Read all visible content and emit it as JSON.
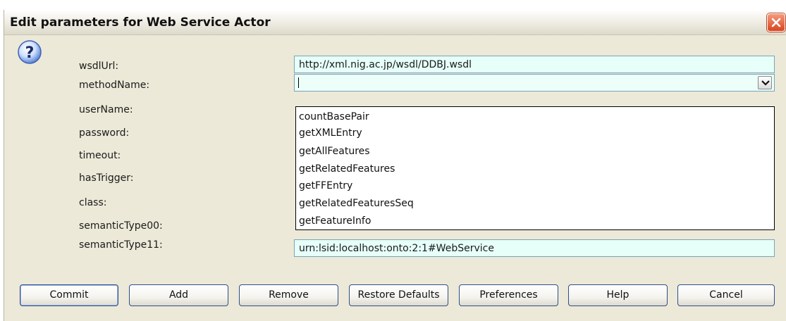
{
  "window": {
    "title": "Edit parameters for Web Service Actor"
  },
  "params": {
    "labels": [
      "wsdlUrl:",
      "methodName:",
      "userName:",
      "password:",
      "timeout:",
      "hasTrigger:",
      "class:",
      "semanticType00:",
      "semanticType11:"
    ],
    "wsdlUrl_value": "http://xml.nig.ac.jp/wsdl/DDBJ.wsdl",
    "semanticType11_value": "urn:lsid:localhost:onto:2:1#WebService",
    "methodName_value": ""
  },
  "dropdown": {
    "options": [
      "countBasePair",
      "getXMLEntry",
      "getAllFeatures",
      "getRelatedFeatures",
      "getFFEntry",
      "getRelatedFeaturesSeq",
      "getFeatureInfo"
    ]
  },
  "buttons": [
    "Commit",
    "Add",
    "Remove",
    "Restore Defaults",
    "Preferences",
    "Help",
    "Cancel"
  ],
  "icons": {
    "dialog": "question-icon",
    "close": "close-icon",
    "combo": "chevron-down-icon"
  }
}
